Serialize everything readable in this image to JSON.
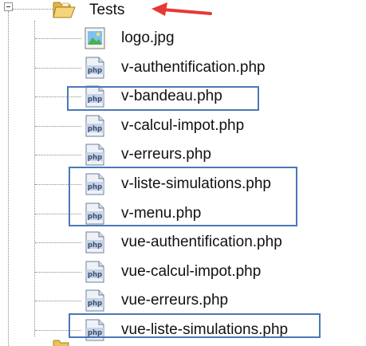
{
  "folder": {
    "name": "Tests",
    "icon": "folder-open-icon"
  },
  "files": [
    {
      "name": "logo.jpg",
      "icon": "image-file-icon",
      "highlighted": false
    },
    {
      "name": "v-authentification.php",
      "icon": "php-file-icon",
      "highlighted": false
    },
    {
      "name": "v-bandeau.php",
      "icon": "php-file-icon",
      "highlighted": true
    },
    {
      "name": "v-calcul-impot.php",
      "icon": "php-file-icon",
      "highlighted": false
    },
    {
      "name": "v-erreurs.php",
      "icon": "php-file-icon",
      "highlighted": false
    },
    {
      "name": "v-liste-simulations.php",
      "icon": "php-file-icon",
      "highlighted": true
    },
    {
      "name": "v-menu.php",
      "icon": "php-file-icon",
      "highlighted": true
    },
    {
      "name": "vue-authentification.php",
      "icon": "php-file-icon",
      "highlighted": false
    },
    {
      "name": "vue-calcul-impot.php",
      "icon": "php-file-icon",
      "highlighted": false
    },
    {
      "name": "vue-erreurs.php",
      "icon": "php-file-icon",
      "highlighted": false
    },
    {
      "name": "vue-liste-simulations.php",
      "icon": "php-file-icon",
      "highlighted": true
    }
  ],
  "php_icon_text": "php",
  "colors": {
    "highlight_border": "#4a78b8",
    "arrow": "#e53935",
    "folder": "#e8c25a"
  }
}
